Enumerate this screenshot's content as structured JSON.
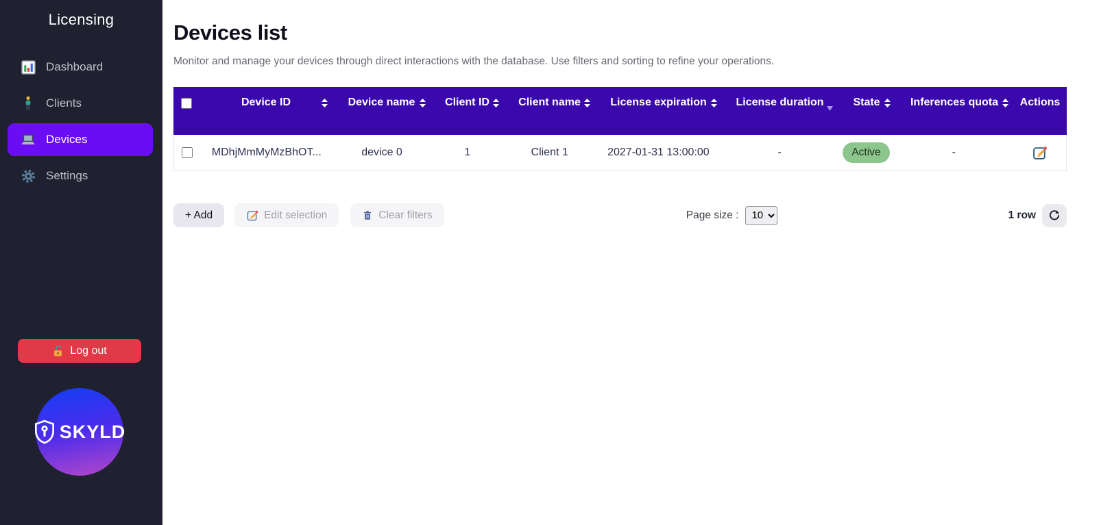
{
  "colors": {
    "sidebar_bg": "#1f2030",
    "active_nav_bg": "#6b0df2",
    "table_header_bg": "#3a08ac",
    "logout_red": "#e13948",
    "badge_green": "#8cc68c"
  },
  "sidebar": {
    "title": "Licensing",
    "items": [
      {
        "label": "Dashboard",
        "icon": "bar-chart-icon",
        "active": false
      },
      {
        "label": "Clients",
        "icon": "person-icon",
        "active": false
      },
      {
        "label": "Devices",
        "icon": "laptop-icon",
        "active": true
      },
      {
        "label": "Settings",
        "icon": "gear-icon",
        "active": false
      }
    ],
    "logout_label": "Log out",
    "logout_icon": "open-lock-icon",
    "logo_text": "SKYLD",
    "logo_icon": "shield-icon"
  },
  "main": {
    "title": "Devices list",
    "subtitle": "Monitor and manage your devices through direct interactions with the database. Use filters and sorting to refine your operations.",
    "table": {
      "columns": [
        {
          "label": "Device ID",
          "sort": "both"
        },
        {
          "label": "Device name",
          "sort": "both"
        },
        {
          "label": "Client ID",
          "sort": "both"
        },
        {
          "label": "Client name",
          "sort": "both"
        },
        {
          "label": "License expiration",
          "sort": "both"
        },
        {
          "label": "License duration",
          "sort": "desc"
        },
        {
          "label": "State",
          "sort": "both"
        },
        {
          "label": "Inferences quota",
          "sort": "both"
        },
        {
          "label": "Actions",
          "sort": "none"
        }
      ],
      "row": {
        "device_id": "MDhjMmMyMzBhOT...",
        "device_name": "device 0",
        "client_id": "1",
        "client_name": "Client 1",
        "license_expiration": "2027-01-31 13:00:00",
        "license_duration": "-",
        "state": "Active",
        "inferences_quota": "-",
        "action_icon": "edit-icon"
      }
    },
    "toolbar": {
      "add_label": "+ Add",
      "edit_label": "Edit selection",
      "edit_icon": "edit-icon",
      "clear_label": "Clear filters",
      "clear_icon": "trash-icon"
    },
    "pagination": {
      "page_size_label": "Page size :",
      "page_size": "10",
      "row_count": "1 row",
      "refresh_icon": "refresh-icon"
    }
  }
}
